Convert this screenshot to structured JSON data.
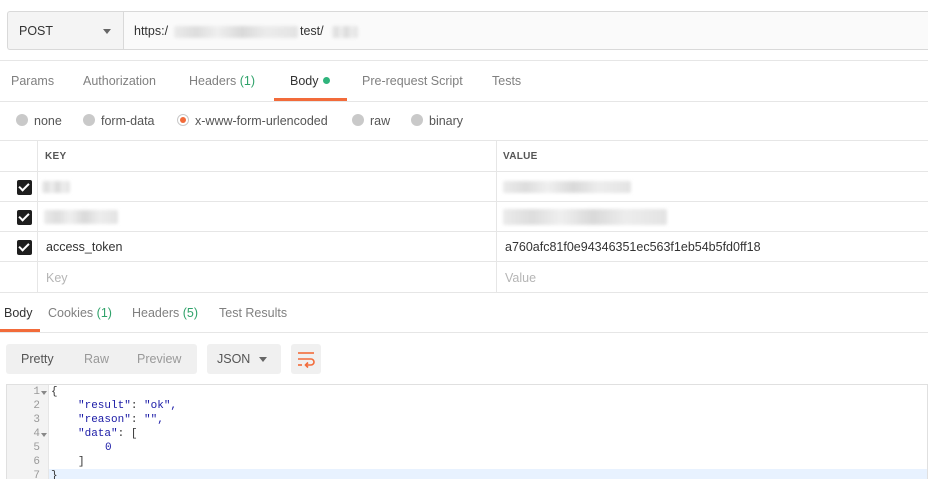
{
  "request": {
    "method": "POST",
    "url_prefix": "https:/",
    "url_middle": "test/"
  },
  "request_tabs": [
    {
      "label": "Params",
      "count": ""
    },
    {
      "label": "Authorization",
      "count": ""
    },
    {
      "label": "Headers",
      "count": "(1)"
    },
    {
      "label": "Body",
      "count": ""
    },
    {
      "label": "Pre-request Script",
      "count": ""
    },
    {
      "label": "Tests",
      "count": ""
    }
  ],
  "body_types": [
    "none",
    "form-data",
    "x-www-form-urlencoded",
    "raw",
    "binary"
  ],
  "params": {
    "key_header": "KEY",
    "value_header": "VALUE",
    "rows": [
      {
        "key": "",
        "value": ""
      },
      {
        "key": "",
        "value": ""
      },
      {
        "key": "access_token",
        "value": "a760afc81f0e94346351ec563f1eb54b5fd0ff18"
      }
    ],
    "key_placeholder": "Key",
    "value_placeholder": "Value"
  },
  "response_tabs": [
    {
      "label": "Body",
      "count": ""
    },
    {
      "label": "Cookies",
      "count": "(1)"
    },
    {
      "label": "Headers",
      "count": "(5)"
    },
    {
      "label": "Test Results",
      "count": ""
    }
  ],
  "response_view": {
    "pretty": "Pretty",
    "raw": "Raw",
    "preview": "Preview",
    "format": "JSON"
  },
  "code_lines": [
    {
      "no": "1",
      "text": "{"
    },
    {
      "no": "2",
      "key": "\"result\"",
      "val": "\"ok\","
    },
    {
      "no": "3",
      "key": "\"reason\"",
      "val": "\"\","
    },
    {
      "no": "4",
      "key": "\"data\"",
      "val": "["
    },
    {
      "no": "5",
      "text": "0"
    },
    {
      "no": "6",
      "text": "]"
    },
    {
      "no": "7",
      "text": "}"
    }
  ],
  "colors": {
    "accent": "#f26b3a",
    "green": "#2fb47c"
  }
}
